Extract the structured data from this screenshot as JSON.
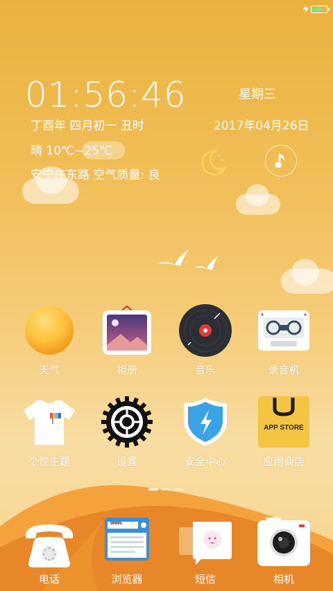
{
  "status_bar": {
    "battery_level": 0.75
  },
  "clock_widget": {
    "time": "01:56:46",
    "weekday": "星期三",
    "lunar_date": "丁酉年 四月初一  丑时",
    "solar_date": "2017年04月26日",
    "weather": "晴   10℃~25℃",
    "location_air": "安宁庄东路   空气质量: 良"
  },
  "apps": [
    {
      "label": "天气",
      "icon": "sun-icon"
    },
    {
      "label": "相册",
      "icon": "photo-frame-icon"
    },
    {
      "label": "音乐",
      "icon": "vinyl-record-icon"
    },
    {
      "label": "录音机",
      "icon": "cassette-icon"
    },
    {
      "label": "个性主题",
      "icon": "tshirt-icon"
    },
    {
      "label": "设置",
      "icon": "gear-icon"
    },
    {
      "label": "安全中心",
      "icon": "shield-icon"
    },
    {
      "label": "应用商店",
      "icon": "app-store-icon",
      "icon_text": "APP STORE"
    }
  ],
  "dock": [
    {
      "label": "电话",
      "icon": "phone-icon"
    },
    {
      "label": "浏览器",
      "icon": "browser-icon",
      "icon_text": "www."
    },
    {
      "label": "短信",
      "icon": "message-icon"
    },
    {
      "label": "相机",
      "icon": "camera-icon"
    }
  ],
  "page_indicator": {
    "pages": 3,
    "current": 1
  },
  "colors": {
    "background_top": "#ebb13f",
    "background_bottom": "#f8dda2",
    "dune": "#e8862a",
    "shield_blue": "#3aa3e6",
    "app_store_yellow": "#f5c443"
  }
}
